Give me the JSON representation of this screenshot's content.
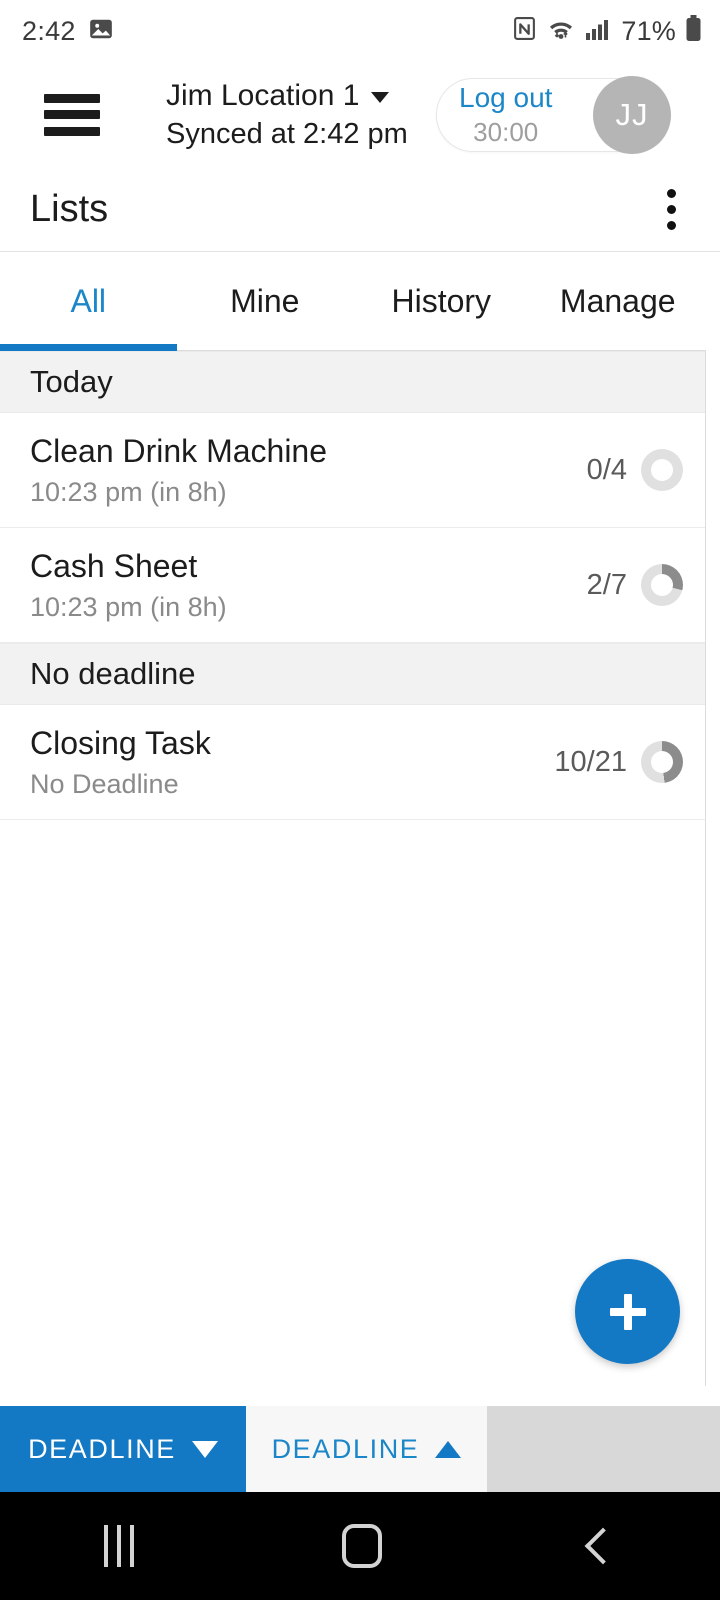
{
  "status_bar": {
    "time": "2:42",
    "image_icon": "photo-icon",
    "nfc_icon": "nfc-icon",
    "wifi_icon": "wifi-icon",
    "signal_icon": "signal-bars-icon",
    "battery_percent": "71%",
    "battery_icon": "battery-icon"
  },
  "app_bar": {
    "menu_icon": "hamburger-menu-icon",
    "location_name": "Jim Location 1",
    "location_chevron": "chevron-down-icon",
    "sync_status": "Synced at 2:42 pm",
    "logout_label": "Log out",
    "logout_timer": "30:00",
    "avatar_initials": "JJ"
  },
  "title_bar": {
    "title": "Lists",
    "overflow_icon": "kebab-menu-icon"
  },
  "tabs": {
    "active_index": 0,
    "items": [
      {
        "label": "All"
      },
      {
        "label": "Mine"
      },
      {
        "label": "History"
      },
      {
        "label": "Manage"
      }
    ]
  },
  "list": {
    "sections": [
      {
        "header": "Today",
        "rows": [
          {
            "title": "Clean Drink Machine",
            "subtitle": "10:23 pm (in 8h)",
            "count": "0/4",
            "progress_pct": 0
          },
          {
            "title": "Cash Sheet",
            "subtitle": "10:23 pm (in 8h)",
            "count": "2/7",
            "progress_pct": 29
          }
        ]
      },
      {
        "header": "No deadline",
        "rows": [
          {
            "title": "Closing Task",
            "subtitle": "No Deadline",
            "count": "10/21",
            "progress_pct": 48
          }
        ]
      }
    ]
  },
  "fab": {
    "icon": "plus-icon",
    "label": "Add"
  },
  "sort_bar": {
    "buttons": [
      {
        "label": "DEADLINE",
        "direction": "down",
        "active": true
      },
      {
        "label": "DEADLINE",
        "direction": "up",
        "active": false
      }
    ]
  },
  "nav_bar": {
    "recents_icon": "recents-icon",
    "home_icon": "home-icon",
    "back_icon": "back-icon"
  },
  "colors": {
    "accent": "#1479c4",
    "link": "#1b86c8",
    "section_bg": "#f2f2f2",
    "progress_track": "#e0e0e0",
    "progress_fill": "#8c8c8c"
  }
}
